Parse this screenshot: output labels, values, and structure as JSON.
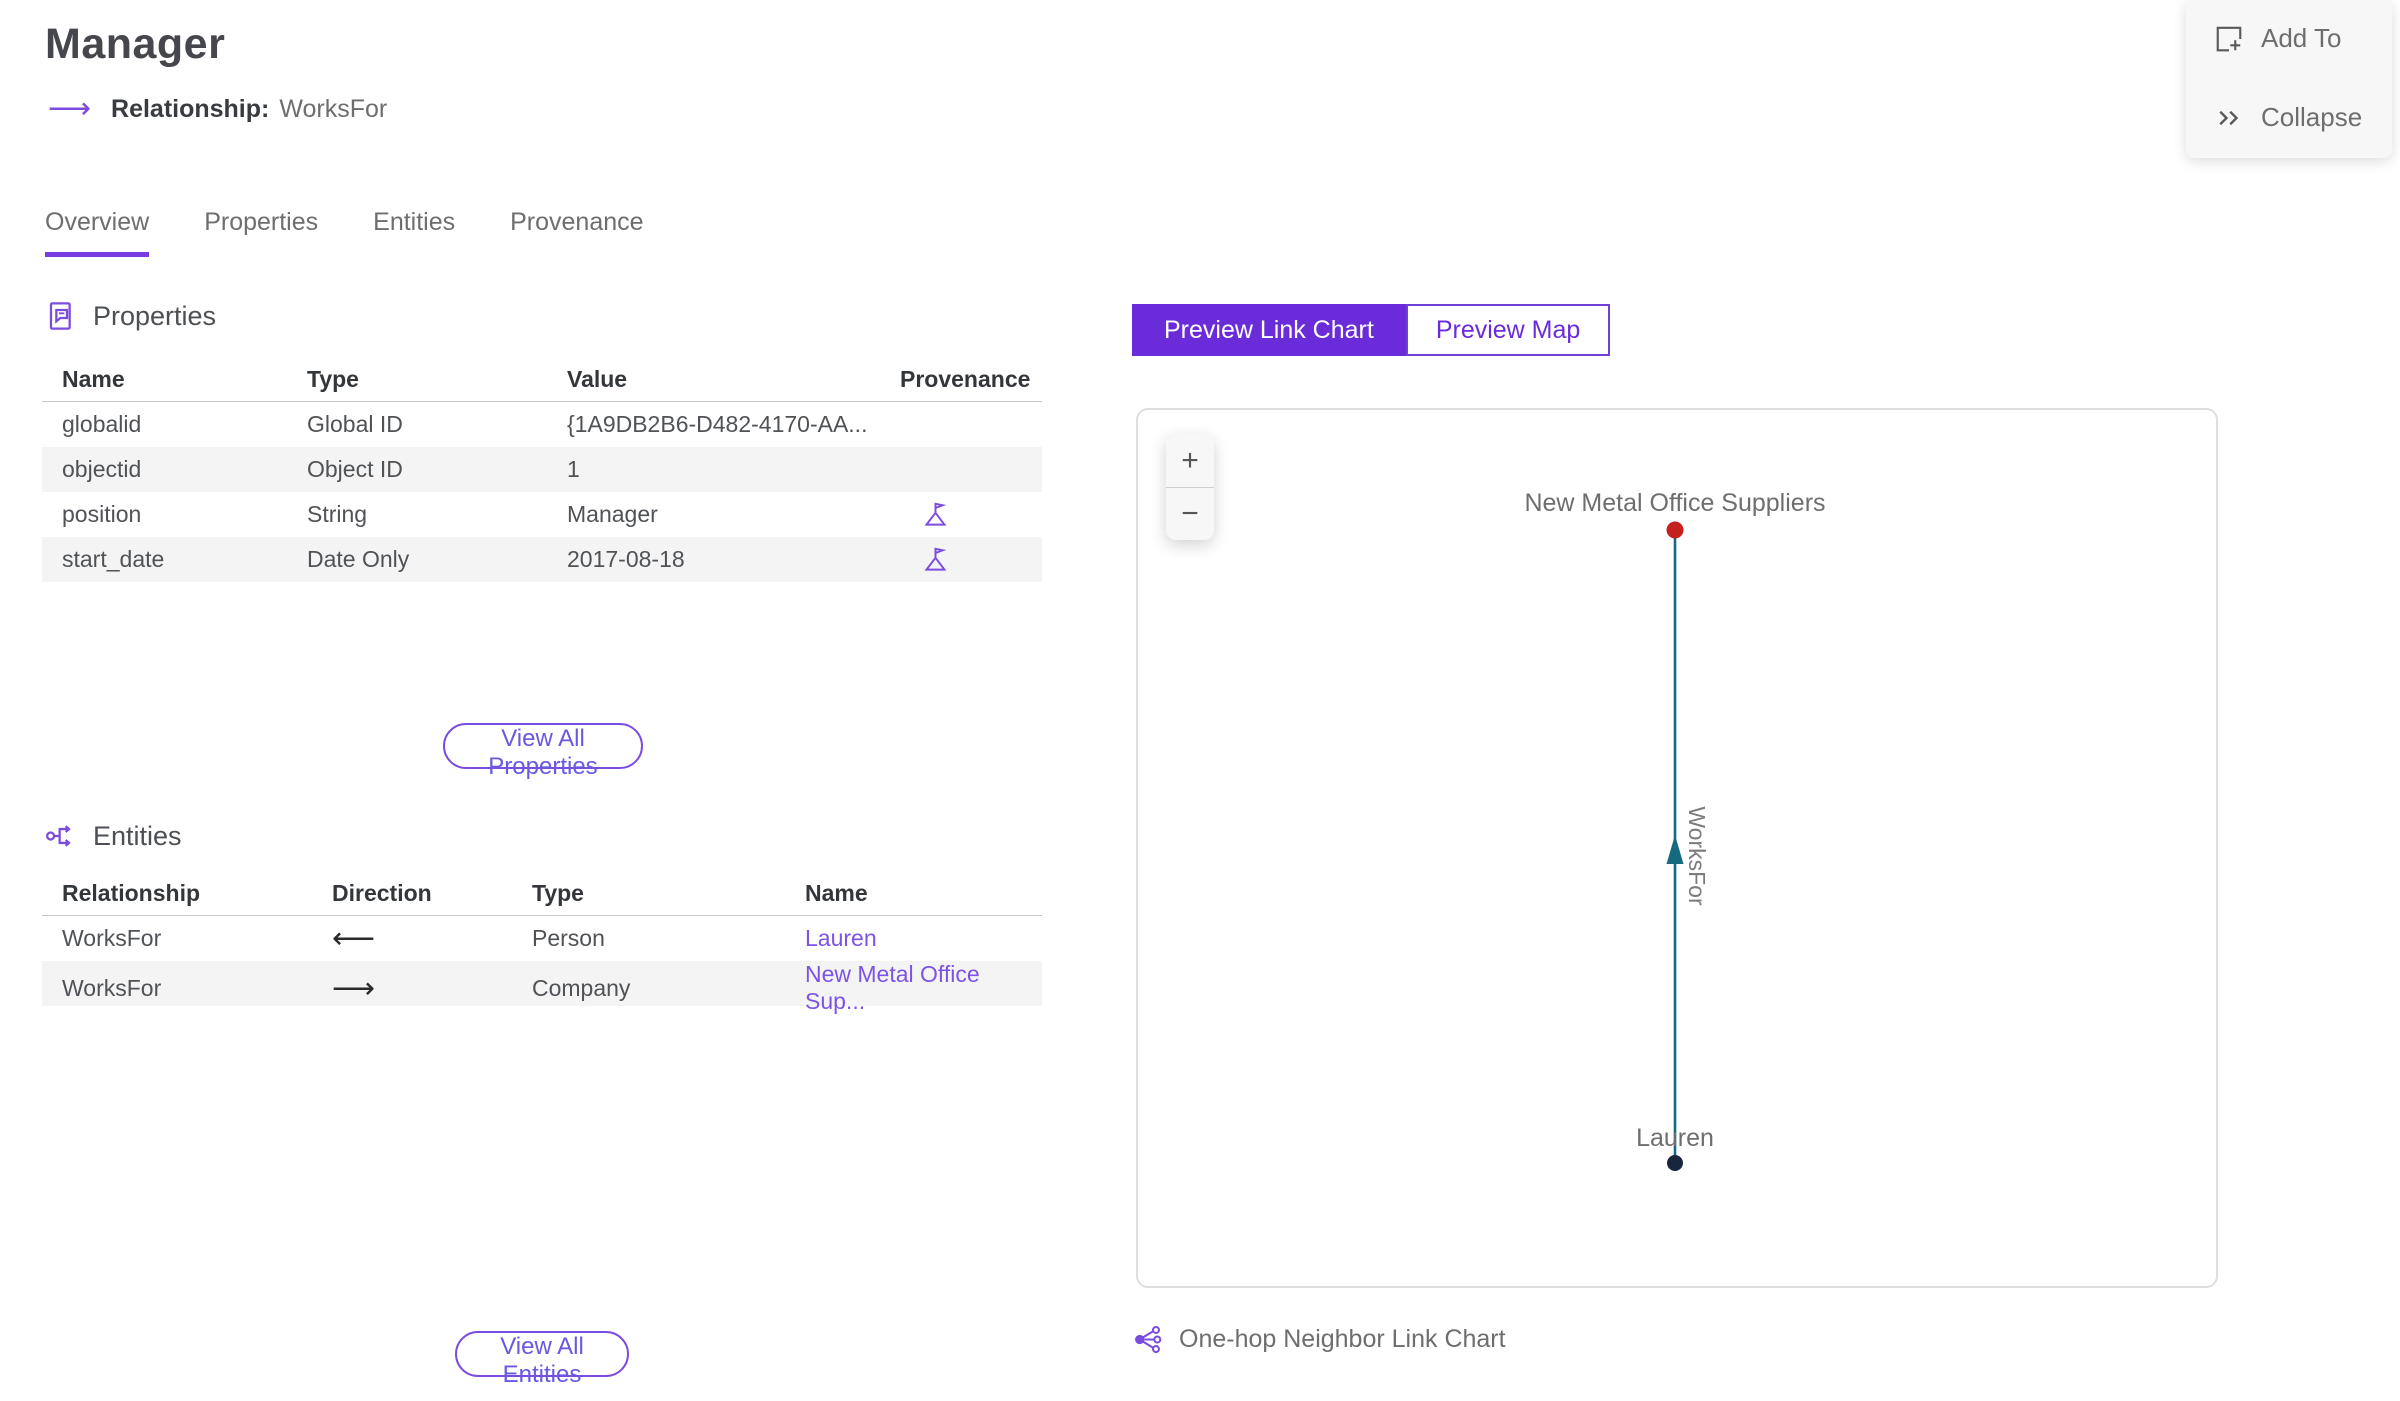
{
  "header": {
    "title": "Manager",
    "subtitle_label": "Relationship:",
    "subtitle_value": "WorksFor"
  },
  "actions": {
    "add_to": "Add To",
    "collapse": "Collapse"
  },
  "tabs": [
    {
      "label": "Overview"
    },
    {
      "label": "Properties"
    },
    {
      "label": "Entities"
    },
    {
      "label": "Provenance"
    }
  ],
  "properties_section": {
    "title": "Properties",
    "columns": [
      "Name",
      "Type",
      "Value",
      "Provenance"
    ],
    "rows": [
      {
        "name": "globalid",
        "type": "Global ID",
        "value": "{1A9DB2B6-D482-4170-AA..."
      },
      {
        "name": "objectid",
        "type": "Object ID",
        "value": "1"
      },
      {
        "name": "position",
        "type": "String",
        "value": "Manager"
      },
      {
        "name": "start_date",
        "type": "Date Only",
        "value": "2017-08-18"
      }
    ],
    "view_all_label": "View All Properties"
  },
  "entities_section": {
    "title": "Entities",
    "columns": [
      "Relationship",
      "Direction",
      "Type",
      "Name"
    ],
    "rows": [
      {
        "relationship": "WorksFor",
        "direction": "⟵",
        "type": "Person",
        "name": "Lauren"
      },
      {
        "relationship": "WorksFor",
        "direction": "⟶",
        "type": "Company",
        "name": "New Metal Office Sup..."
      }
    ],
    "view_all_label": "View All Entities"
  },
  "preview": {
    "toggle_link_chart": "Preview Link Chart",
    "toggle_map": "Preview Map",
    "zoom_in": "+",
    "zoom_out": "−",
    "caption": "One-hop Neighbor Link Chart"
  },
  "chart_data": {
    "type": "node-link",
    "nodes": [
      {
        "label": "New Metal Office Suppliers",
        "entity_type": "Company",
        "color": "#c4211e"
      },
      {
        "label": "Lauren",
        "entity_type": "Person",
        "color": "#17253d"
      }
    ],
    "edges": [
      {
        "label": "WorksFor",
        "from": "Lauren",
        "to": "New Metal Office Suppliers",
        "color": "#156a80"
      }
    ]
  },
  "colors": {
    "accent_purple": "#6a2cd9",
    "link_purple": "#7d53e6",
    "underline_purple": "#7a3be2",
    "icon_purple": "#7b4ce0",
    "edge_teal": "#156a80",
    "node_red": "#c4211e",
    "node_dark": "#17253d",
    "row_alt": "#f4f4f4"
  }
}
